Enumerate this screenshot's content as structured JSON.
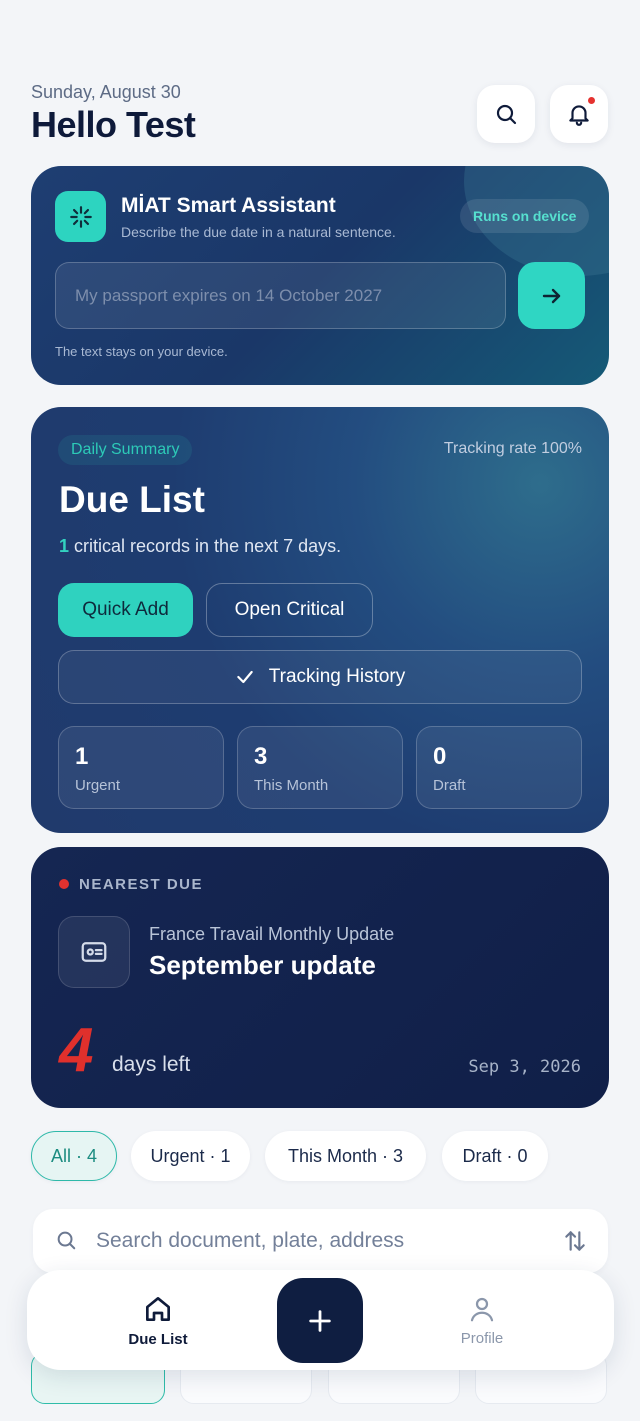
{
  "header": {
    "date": "Sunday, August 30",
    "greeting": "Hello Test",
    "search_icon": "search-icon",
    "bell_icon": "bell-icon",
    "has_notification": true
  },
  "assistant": {
    "title": "MİAT Smart Assistant",
    "subtitle": "Describe the due date in a natural sentence.",
    "badge": "Runs on device",
    "input_placeholder": "My passport expires on 14 October 2027",
    "note": "The text stays on your device."
  },
  "summary": {
    "pill": "Daily Summary",
    "tracking_rate": "Tracking rate 100%",
    "title": "Due List",
    "critical_count": "1",
    "critical_text": " critical records in the next 7 days.",
    "quick_add": "Quick Add",
    "open_critical": "Open Critical",
    "tracking_history": "Tracking History",
    "stats": [
      {
        "value": "1",
        "label": "Urgent"
      },
      {
        "value": "3",
        "label": "This Month"
      },
      {
        "value": "0",
        "label": "Draft"
      }
    ]
  },
  "nearest": {
    "label": "NEAREST DUE",
    "org": "France Travail Monthly Update",
    "title": "September update",
    "days": "4",
    "days_label": "days left",
    "date": "Sep 3, 2026"
  },
  "filters": [
    {
      "label": "All · 4",
      "active": true
    },
    {
      "label": "Urgent · 1",
      "active": false
    },
    {
      "label": "This Month · 3",
      "active": false
    },
    {
      "label": "Draft · 0",
      "active": false
    }
  ],
  "search": {
    "placeholder": "Search document, plate, address"
  },
  "nav": {
    "due_list": "Due List",
    "profile": "Profile"
  },
  "colors": {
    "accent": "#2fd2bf",
    "navy": "#0f1e41",
    "alert": "#e3322f"
  }
}
